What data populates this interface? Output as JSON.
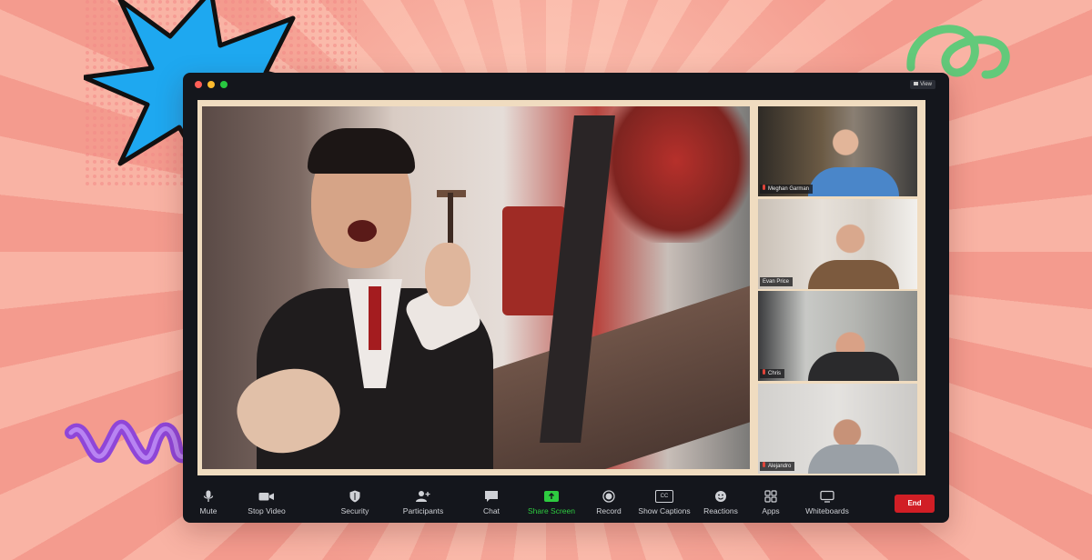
{
  "window": {
    "view_label": "View"
  },
  "participants": [
    {
      "name": "Meghan Garman"
    },
    {
      "name": "Evan Price"
    },
    {
      "name": "Chris"
    },
    {
      "name": "Alejandro"
    }
  ],
  "toolbar": {
    "mute": "Mute",
    "stop_video": "Stop Video",
    "security": "Security",
    "participants": "Participants",
    "chat": "Chat",
    "share_screen": "Share Screen",
    "record": "Record",
    "show_captions": "Show Captions",
    "captions_icon_text": "CC",
    "reactions": "Reactions",
    "apps": "Apps",
    "whiteboards": "Whiteboards",
    "end": "End"
  },
  "colors": {
    "share_accent": "#2ecc40",
    "end_button": "#d11e25",
    "window_bg": "#14161c"
  }
}
